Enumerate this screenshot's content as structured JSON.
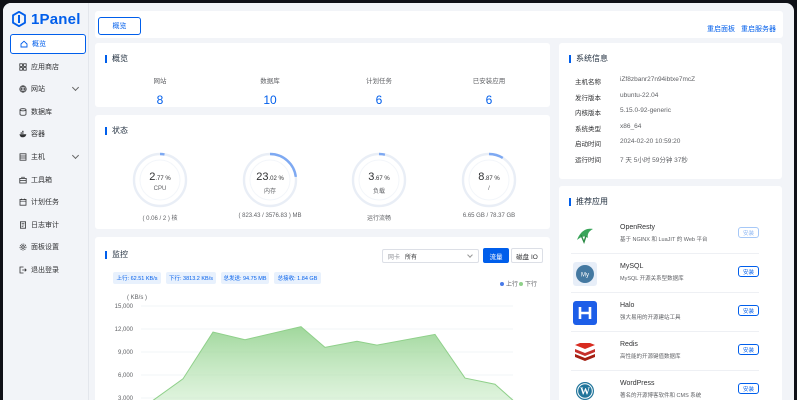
{
  "logo": {
    "text": "1Panel"
  },
  "sidebar": {
    "items": [
      {
        "label": "概览",
        "icon": "home-icon",
        "active": true,
        "chevron": false
      },
      {
        "label": "应用商店",
        "icon": "apps-icon",
        "chevron": false
      },
      {
        "label": "网站",
        "icon": "globe-icon",
        "chevron": true
      },
      {
        "label": "数据库",
        "icon": "database-icon",
        "chevron": false
      },
      {
        "label": "容器",
        "icon": "docker-icon",
        "chevron": false
      },
      {
        "label": "主机",
        "icon": "server-icon",
        "chevron": true
      },
      {
        "label": "工具箱",
        "icon": "toolbox-icon",
        "chevron": false
      },
      {
        "label": "计划任务",
        "icon": "calendar-icon",
        "chevron": false
      },
      {
        "label": "日志审计",
        "icon": "log-icon",
        "chevron": false
      },
      {
        "label": "面板设置",
        "icon": "settings-icon",
        "chevron": false
      },
      {
        "label": "退出登录",
        "icon": "logout-icon",
        "chevron": false
      }
    ]
  },
  "header": {
    "tab": "概览",
    "restart_panel": "重启面板",
    "restart_server": "重启服务器"
  },
  "overview": {
    "title": "概览",
    "items": [
      {
        "label": "网站",
        "value": "8"
      },
      {
        "label": "数据库",
        "value": "10"
      },
      {
        "label": "计划任务",
        "value": "6"
      },
      {
        "label": "已安装应用",
        "value": "6"
      }
    ]
  },
  "status": {
    "title": "状态",
    "gauges": [
      {
        "int": "2",
        "dec": ".77 %",
        "name": "CPU",
        "foot": "( 0.06 / 2 ) 核",
        "percent": 2.77
      },
      {
        "int": "23",
        "dec": ".02 %",
        "name": "内存",
        "foot": "( 823.43 / 3576.83 ) MB",
        "percent": 23.02
      },
      {
        "int": "3",
        "dec": ".67 %",
        "name": "负载",
        "foot": "运行流畅",
        "percent": 3.67
      },
      {
        "int": "8",
        "dec": ".87 %",
        "name": "/",
        "foot": "6.65 GB / 78.37 GB",
        "percent": 8.87
      }
    ]
  },
  "sysinfo": {
    "title": "系统信息",
    "rows": [
      {
        "key": "主机名称",
        "value": "iZf8zbanr27n94ibtxe7mcZ"
      },
      {
        "key": "发行版本",
        "value": "ubuntu-22.04"
      },
      {
        "key": "内核版本",
        "value": "5.15.0-92-generic"
      },
      {
        "key": "系统类型",
        "value": "x86_64"
      },
      {
        "key": "启动时间",
        "value": "2024-02-20 10:59:20"
      },
      {
        "key": "运行时间",
        "value": "7 天 5小时 59分钟 37秒"
      }
    ]
  },
  "apps": {
    "title": "推荐应用",
    "items": [
      {
        "name": "OpenResty",
        "desc": "基于 NGINX 和 LuaJIT 的 Web 平台",
        "button": "安装",
        "disabled": true,
        "icon": "openresty-icon"
      },
      {
        "name": "MySQL",
        "desc": "MySQL 开源关系型数据库",
        "button": "安装",
        "disabled": false,
        "icon": "mysql-icon"
      },
      {
        "name": "Halo",
        "desc": "强大易用的开源建站工具",
        "button": "安装",
        "disabled": false,
        "icon": "halo-icon"
      },
      {
        "name": "Redis",
        "desc": "高性能的开源键值数据库",
        "button": "安装",
        "disabled": false,
        "icon": "redis-icon"
      },
      {
        "name": "WordPress",
        "desc": "著名的开源博客软件和 CMS 系统",
        "button": "安装",
        "disabled": false,
        "icon": "wordpress-icon"
      }
    ]
  },
  "monitor": {
    "title": "监控",
    "select_prefix": "网卡",
    "select_value": "所有",
    "seg_traffic": "流量",
    "seg_disk": "磁盘 IO",
    "chips": [
      "上行: 62.51 KB/s",
      "下行: 3813.2 KB/s",
      "总发送: 94.75 MB",
      "总接收: 1.84 GB"
    ],
    "legend_up": "上行",
    "legend_down": "下行",
    "unit": "( KB/s )",
    "colors": {
      "up": "#4a7be8",
      "down": "#8fd08a"
    }
  },
  "chart_data": {
    "type": "area",
    "ylabel": "( KB/s )",
    "ylim": [
      0,
      15000
    ],
    "yticks": [
      "15,000",
      "12,000",
      "9,000",
      "6,000",
      "3,000"
    ],
    "yvalues": [
      15000,
      12000,
      9000,
      6000,
      3000
    ],
    "series": [
      {
        "name": "下行",
        "values": [
          0,
          5500,
          11600,
          10600,
          12300,
          9600,
          10400,
          9900,
          11300,
          5600,
          4800,
          2700
        ]
      },
      {
        "name": "上行",
        "values": [
          0,
          0,
          0,
          0,
          0,
          0,
          0,
          0,
          0,
          0,
          0,
          0
        ]
      }
    ]
  },
  "colors": {
    "accent": "#005eeb"
  }
}
